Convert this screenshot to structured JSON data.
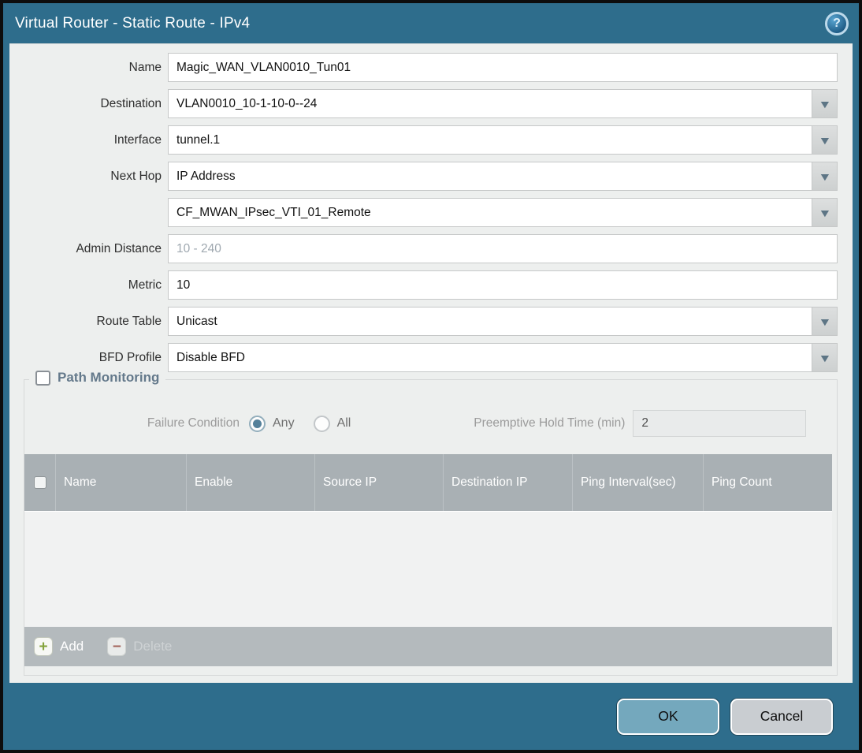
{
  "colors": {
    "frame_teal": "#2e6d8c",
    "content_bg": "#edefee",
    "table_header_gray": "#a9b0b4",
    "toolbar_gray": "#b4babd",
    "ok_button": "#74a8bd",
    "cancel_button": "#c9cdd1",
    "add_plus_green": "#84a33c",
    "delete_minus_red": "#a2655c"
  },
  "icons": {
    "help": "?",
    "dropdown": "▼",
    "add": "+",
    "delete": "−"
  },
  "titlebar": {
    "title": "Virtual Router - Static Route - IPv4"
  },
  "form": {
    "name": {
      "label": "Name",
      "value": "Magic_WAN_VLAN0010_Tun01"
    },
    "destination": {
      "label": "Destination",
      "value": "VLAN0010_10-1-10-0--24"
    },
    "interface": {
      "label": "Interface",
      "value": "tunnel.1"
    },
    "next_hop": {
      "label": "Next Hop",
      "value": "IP Address"
    },
    "next_hop_address": {
      "value": "CF_MWAN_IPsec_VTI_01_Remote"
    },
    "admin_distance": {
      "label": "Admin Distance",
      "placeholder": "10 - 240",
      "value": ""
    },
    "metric": {
      "label": "Metric",
      "value": "10"
    },
    "route_table": {
      "label": "Route Table",
      "value": "Unicast"
    },
    "bfd_profile": {
      "label": "BFD Profile",
      "value": "Disable BFD"
    }
  },
  "path_monitoring": {
    "title": "Path Monitoring",
    "enabled": false,
    "failure_condition": {
      "label": "Failure Condition",
      "options": [
        "Any",
        "All"
      ],
      "selected": "Any"
    },
    "preemptive_hold_time": {
      "label": "Preemptive Hold Time (min)",
      "value": "2"
    },
    "table": {
      "columns": [
        "Name",
        "Enable",
        "Source IP",
        "Destination IP",
        "Ping Interval(sec)",
        "Ping Count"
      ],
      "rows": []
    },
    "toolbar": {
      "add_label": "Add",
      "delete_label": "Delete"
    }
  },
  "footer": {
    "ok_label": "OK",
    "cancel_label": "Cancel"
  }
}
